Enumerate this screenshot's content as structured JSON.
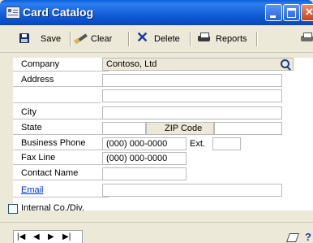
{
  "window": {
    "title": "Card Catalog"
  },
  "toolbar": {
    "save_label": "Save",
    "clear_label": "Clear",
    "delete_label": "Delete",
    "reports_label": "Reports"
  },
  "form": {
    "company_label": "Company",
    "company_value": "Contoso, Ltd",
    "address_label": "Address",
    "address_line1": "",
    "address_line2": "",
    "city_label": "City",
    "city_value": "",
    "state_label": "State",
    "state_value": "",
    "zip_label": "ZIP Code",
    "zip_value": "",
    "business_phone_label": "Business Phone",
    "business_phone_value": "(000) 000-0000",
    "ext_label": "Ext.",
    "ext_value": "",
    "fax_label": "Fax Line",
    "fax_value": "(000) 000-0000",
    "contact_label": "Contact Name",
    "contact_value": "",
    "email_label": "Email",
    "email_value": "",
    "internal_label": "Internal Co./Div.",
    "internal_checked": false
  },
  "navigation": {
    "first": "|◀",
    "prev": "◀",
    "next": "▶",
    "last": "▶|"
  },
  "icons": [
    "card-catalog-icon",
    "save-icon",
    "clear-icon",
    "delete-icon",
    "reports-icon",
    "printer-icon",
    "lookup-icon",
    "note-icon",
    "help-icon"
  ]
}
